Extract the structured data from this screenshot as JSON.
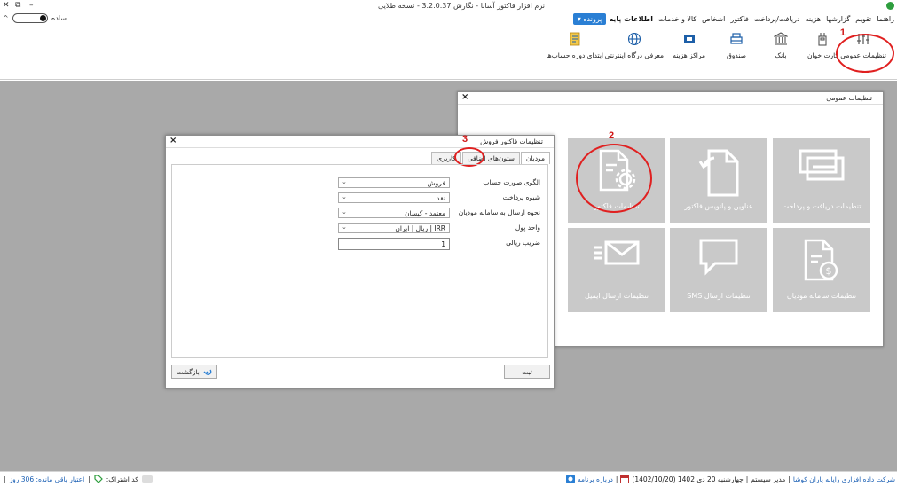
{
  "titlebar": {
    "title": "نرم افزار فاکتور آسانا - نگارش 3.2.0.37 - نسخه طلایی",
    "minimize": "–",
    "restore": "⧉",
    "close": "✕"
  },
  "menu": {
    "file": "پرونده ▾",
    "items": [
      "اطلاعات پایه",
      "کالا و خدمات",
      "اشخاص",
      "فاکتور",
      "دریافت/پرداخت",
      "هزینه",
      "گزارشها",
      "تقویم",
      "راهنما"
    ],
    "toggle_label": "ساده",
    "collapse": "^"
  },
  "ribbon": {
    "items": [
      {
        "label": "تنظیمات عمومی",
        "icon": "sliders-icon"
      },
      {
        "label": "کارت خوان",
        "icon": "card-reader-icon"
      },
      {
        "label": "بانک",
        "icon": "bank-icon"
      },
      {
        "label": "صندوق",
        "icon": "cash-register-icon"
      },
      {
        "label": "مراکز هزینه",
        "icon": "cost-center-icon"
      },
      {
        "label": "معرفی درگاه اینترنتی",
        "icon": "globe-icon"
      },
      {
        "label": "ابتدای دوره حساب‌ها",
        "icon": "ledger-icon"
      }
    ]
  },
  "annotations": {
    "n1": "1",
    "n2": "2",
    "n3": "3"
  },
  "general_window": {
    "title": "تنظیمات عمومی",
    "close": "×",
    "tiles": [
      {
        "label": "تنظیمات دریافت و پرداخت",
        "icon": "payment-cards-icon"
      },
      {
        "label": "عناوین و پانویس فاکتور",
        "icon": "document-refresh-icon"
      },
      {
        "label": "تنظیمات فاکتور",
        "icon": "document-gear-icon"
      },
      {
        "label": "تنظیمات سامانه مودیان",
        "icon": "document-dollar-icon"
      },
      {
        "label": "تنظیمات ارسال SMS",
        "icon": "chat-bubble-icon"
      },
      {
        "label": "تنظیمات ارسال ایمیل",
        "icon": "envelope-icon"
      }
    ]
  },
  "invoice_dialog": {
    "title": "تنظیمات فاکتور فروش",
    "close": "×",
    "tabs": [
      "کاربری",
      "ستون‌های اضافی",
      "مودیان"
    ],
    "fields": [
      {
        "label": "الگوی صورت حساب",
        "value": "فروش",
        "type": "select"
      },
      {
        "label": "شیوه پرداخت",
        "value": "نقد",
        "type": "select"
      },
      {
        "label": "نحوه ارسال به سامانه مودیان",
        "value": "معتمد - کیسان",
        "type": "select"
      },
      {
        "label": "واحد پول",
        "value": "IRR | ریال | ایران",
        "type": "select"
      },
      {
        "label": "ضریب ریالی",
        "value": "1",
        "type": "input"
      }
    ],
    "submit": "ثبت",
    "back": "بازگشت"
  },
  "status": {
    "about": "درباره برنامه",
    "date": "چهارشنبه 20 دی 1402 (1402/10/20)",
    "user": "مدیر سیستم",
    "company": "شرکت داده افزاری رایانه یاران کوشا",
    "credit": "اعتبار باقی مانده: 306 روز",
    "subscription": "کد اشتراک:",
    "sep": "|"
  },
  "colors": {
    "accent": "#2a7fd4",
    "workspace": "#a9a9a9",
    "tile": "#c9c9c9",
    "annotation": "#e02020"
  }
}
